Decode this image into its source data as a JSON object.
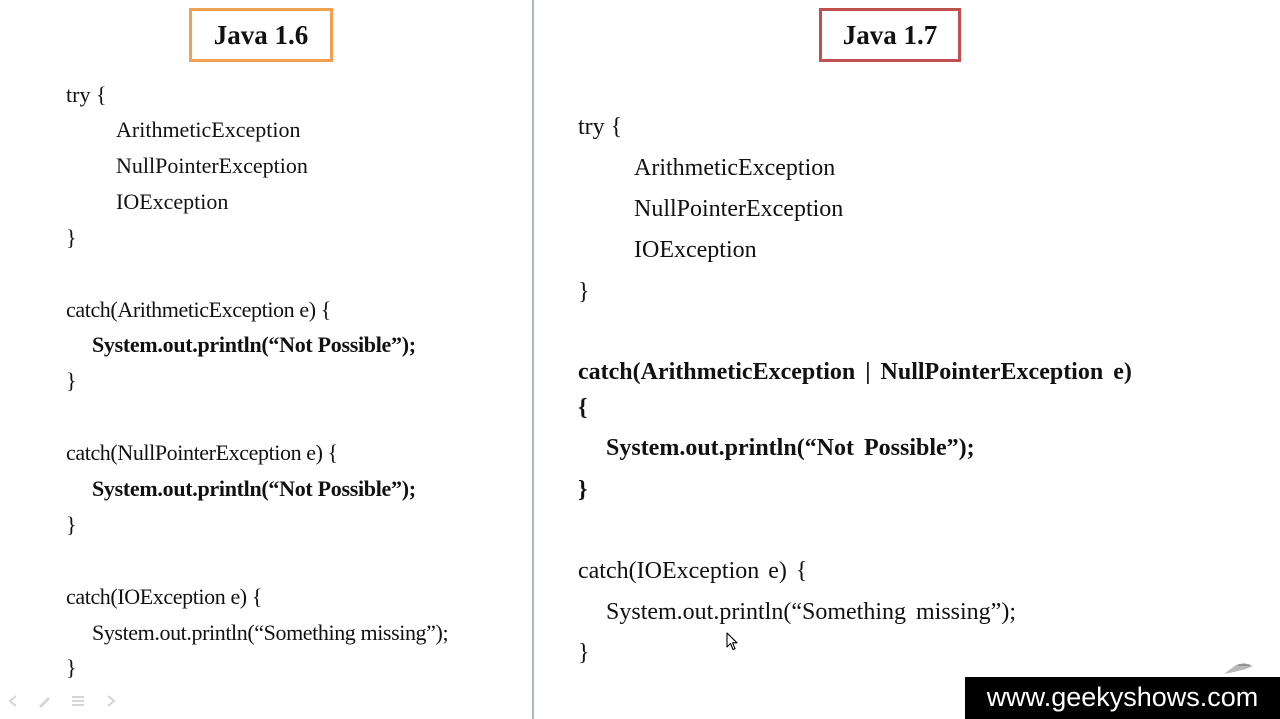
{
  "left_panel": {
    "title": "Java 1.6",
    "lines": [
      "try {",
      "ArithmeticException",
      "NullPointerException",
      "IOException",
      "}",
      "catch(ArithmeticException e) {",
      "System.out.println(“Not Possible”);",
      "}",
      "catch(NullPointerException e) {",
      "System.out.println(“Not Possible”);",
      "}",
      "catch(IOException e) {",
      "System.out.println(“Something missing”);",
      "}"
    ]
  },
  "right_panel": {
    "title": "Java 1.7",
    "lines": [
      "try {",
      "ArithmeticException",
      "NullPointerException",
      "IOException",
      "}",
      "catch(ArithmeticException | NullPointerException e)",
      "{",
      "System.out.println(“Not Possible”);",
      "}",
      "catch(IOException e) {",
      "System.out.println(“Something missing”);",
      "}"
    ]
  },
  "watermark": "www.geekyshows.com",
  "colors": {
    "left_title_border": "#f2a152",
    "right_title_border": "#c0504d",
    "divider": "#aeb9c4",
    "watermark_bg": "#000000"
  },
  "icons": [
    "mouse-pointer-icon",
    "pen-icon",
    "prev-slide-icon",
    "pen-tool-icon",
    "slide-menu-icon",
    "next-slide-icon"
  ]
}
